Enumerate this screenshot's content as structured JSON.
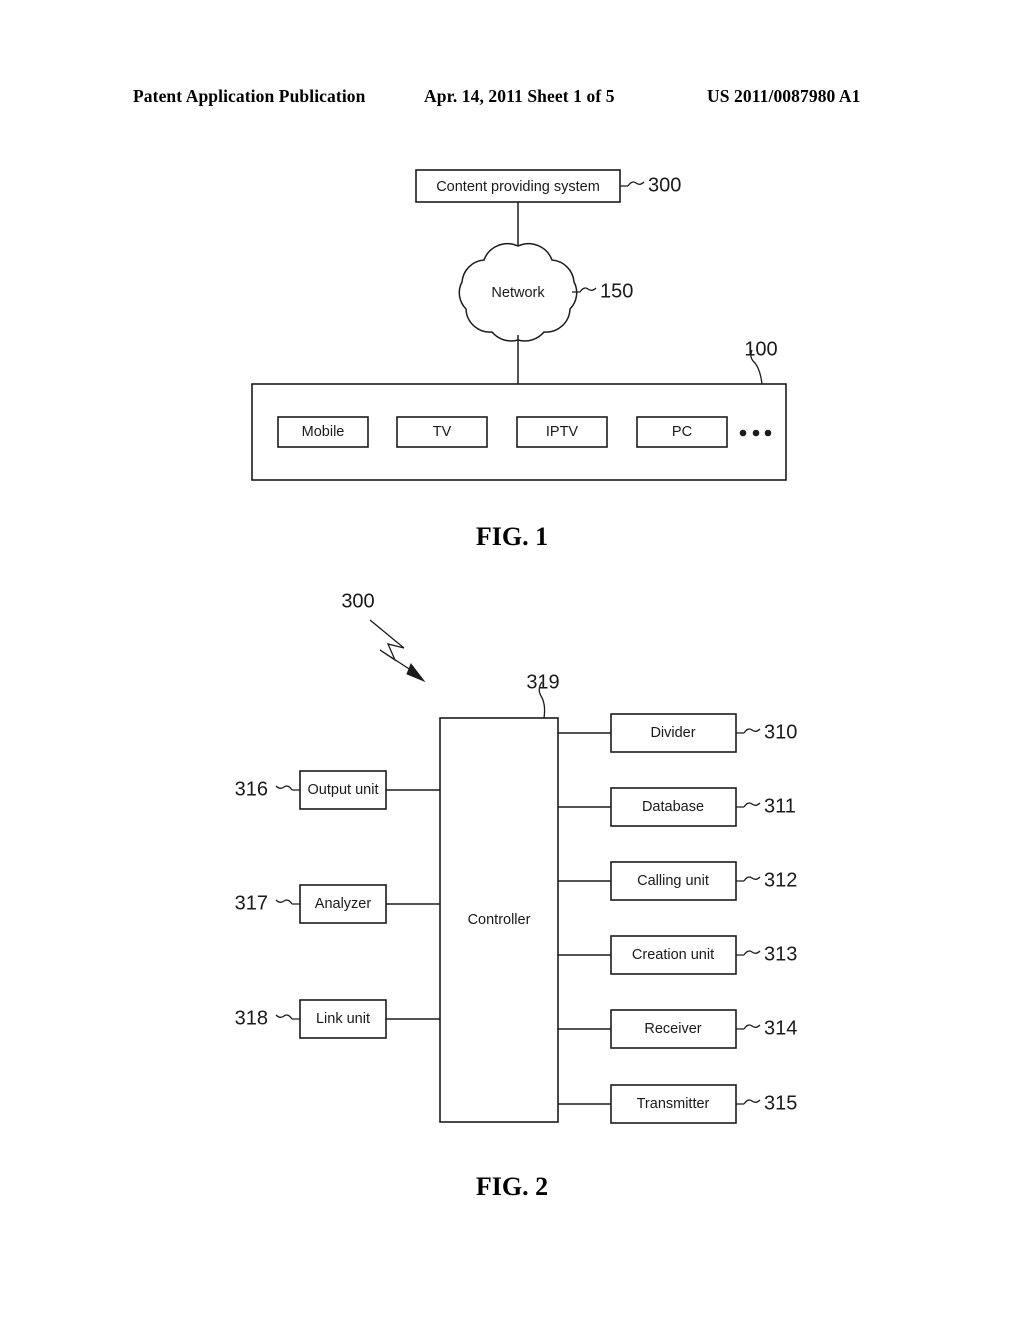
{
  "header": {
    "left": "Patent Application Publication",
    "middle": "Apr. 14, 2011  Sheet 1 of 5",
    "right": "US 2011/0087980 A1"
  },
  "figures": [
    {
      "caption": "FIG. 1",
      "nodes": {
        "content_providing_system": {
          "label": "Content providing system",
          "ref": "300"
        },
        "network": {
          "label": "Network",
          "ref": "150"
        },
        "device_container": {
          "ref": "100"
        },
        "devices": [
          {
            "label": "Mobile"
          },
          {
            "label": "TV"
          },
          {
            "label": "IPTV"
          },
          {
            "label": "PC"
          }
        ],
        "ellipsis": "..."
      }
    },
    {
      "caption": "FIG. 2",
      "nodes": {
        "system_ref": "300",
        "controller": {
          "label": "Controller",
          "ref": "319"
        },
        "left_units": [
          {
            "label": "Output unit",
            "ref": "316"
          },
          {
            "label": "Analyzer",
            "ref": "317"
          },
          {
            "label": "Link unit",
            "ref": "318"
          }
        ],
        "right_units": [
          {
            "label": "Divider",
            "ref": "310"
          },
          {
            "label": "Database",
            "ref": "311"
          },
          {
            "label": "Calling unit",
            "ref": "312"
          },
          {
            "label": "Creation unit",
            "ref": "313"
          },
          {
            "label": "Receiver",
            "ref": "314"
          },
          {
            "label": "Transmitter",
            "ref": "315"
          }
        ]
      }
    }
  ]
}
